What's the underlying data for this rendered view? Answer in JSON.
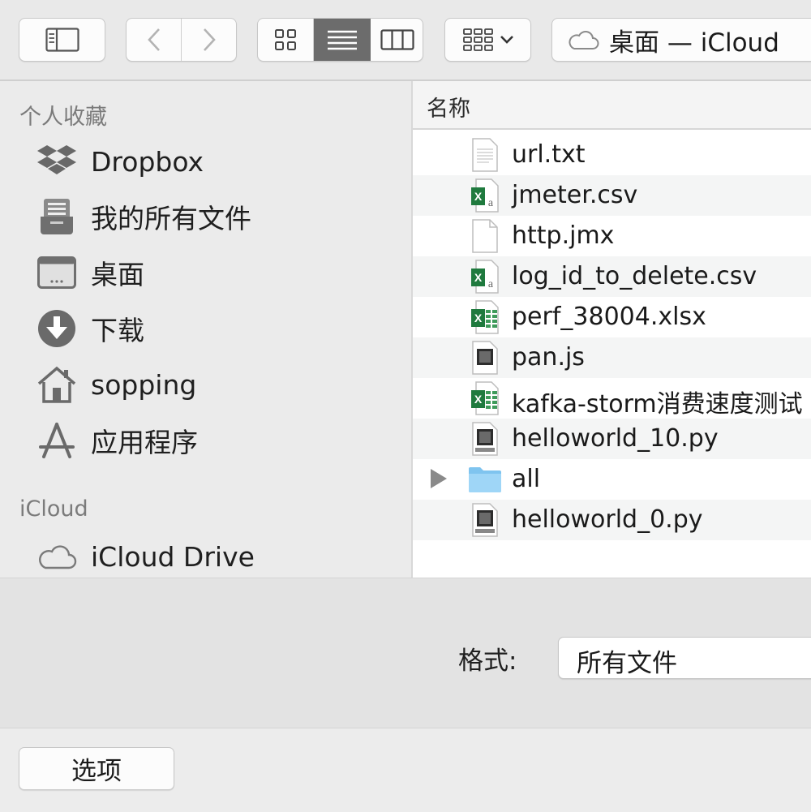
{
  "toolbar": {
    "location_title": "桌面 — iCloud"
  },
  "sidebar": {
    "favorites_header": "个人收藏",
    "favorites": [
      {
        "label": "Dropbox",
        "icon": "dropbox-icon"
      },
      {
        "label": "我的所有文件",
        "icon": "all-files-icon"
      },
      {
        "label": "桌面",
        "icon": "desktop-icon"
      },
      {
        "label": "下载",
        "icon": "download-icon"
      },
      {
        "label": "sopping",
        "icon": "home-icon"
      },
      {
        "label": "应用程序",
        "icon": "applications-icon"
      }
    ],
    "icloud_header": "iCloud",
    "icloud_items": [
      {
        "label": "iCloud Drive",
        "icon": "cloud-icon"
      }
    ]
  },
  "file_list": {
    "column_name": "名称",
    "files": [
      {
        "name": "url.txt",
        "icon": "text-file-icon"
      },
      {
        "name": "jmeter.csv",
        "icon": "csv-file-icon"
      },
      {
        "name": "http.jmx",
        "icon": "blank-file-icon"
      },
      {
        "name": "log_id_to_delete.csv",
        "icon": "csv-file-icon"
      },
      {
        "name": "perf_38004.xlsx",
        "icon": "excel-file-icon"
      },
      {
        "name": "pan.js",
        "icon": "js-file-icon"
      },
      {
        "name": "kafka-storm消费速度测试",
        "icon": "excel-file-icon"
      },
      {
        "name": "helloworld_10.py",
        "icon": "python-file-icon"
      },
      {
        "name": "all",
        "icon": "folder-icon"
      },
      {
        "name": "helloworld_0.py",
        "icon": "python-file-icon"
      }
    ]
  },
  "format": {
    "label": "格式:",
    "selected": "所有文件"
  },
  "footer": {
    "options_label": "选项"
  }
}
